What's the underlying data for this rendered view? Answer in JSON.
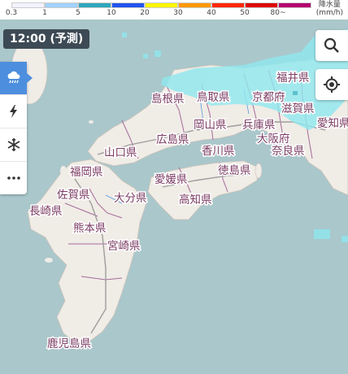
{
  "legend": {
    "colors": [
      "#f2f2ff",
      "#a0d2ff",
      "#2ea7bc",
      "#2255ee",
      "#faf500",
      "#ff9900",
      "#ff2800",
      "#dd0000",
      "#b4006e"
    ],
    "ticks": [
      "0.3",
      "1",
      "5",
      "10",
      "20",
      "30",
      "40",
      "50",
      "80~"
    ],
    "unit_line1": "降水量",
    "unit_line2": "(mm/h)"
  },
  "time_badge": "12:00 (予測)",
  "sidebar": {
    "buttons": [
      {
        "icon": "rain-cloud-icon",
        "active": true
      },
      {
        "icon": "lightning-icon",
        "active": false
      },
      {
        "icon": "snowflake-icon",
        "active": false
      },
      {
        "icon": "more-icon",
        "active": false
      }
    ]
  },
  "controls": {
    "search_icon": "search-icon",
    "locate_icon": "locate-icon"
  },
  "map": {
    "land_color": "#f0ece6",
    "sea_color": "#aac7cb",
    "rain_color": "#8ee8ef",
    "prefectures": [
      "福井県",
      "京都府",
      "滋賀県",
      "愛知県",
      "島根県",
      "鳥取県",
      "岡山県",
      "兵庫県",
      "大阪府",
      "広島県",
      "香川県",
      "奈良県",
      "山口県",
      "福岡県",
      "愛媛県",
      "徳島県",
      "佐賀県",
      "大分県",
      "高知県",
      "長崎県",
      "熊本県",
      "宮崎県",
      "鹿児島県"
    ]
  }
}
